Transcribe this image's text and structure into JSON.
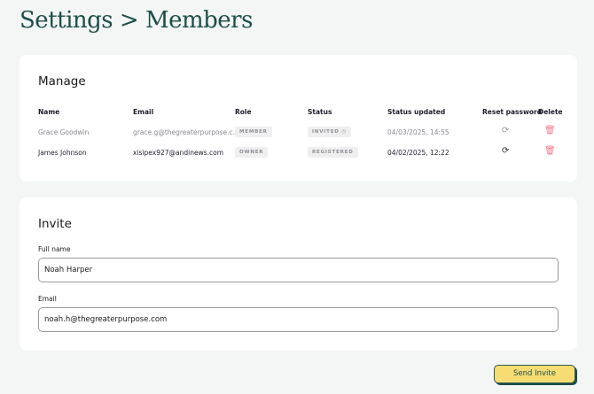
{
  "header": {
    "title": "Settings > Members"
  },
  "manage": {
    "title": "Manage",
    "columns": [
      "Name",
      "Email",
      "Role",
      "Status",
      "Status updated",
      "Reset password",
      "Delete"
    ],
    "rows": [
      {
        "name": "Grace Goodwin",
        "email": "grace.g@thegreaterpurpose.c...",
        "role": "MEMBER",
        "status": "INVITED",
        "status_icon": "clock-icon",
        "updated": "04/03/2025, 14:55",
        "muted": true
      },
      {
        "name": "James Johnson",
        "email": "xisipex927@andinews.com",
        "role": "OWNER",
        "status": "REGISTERED",
        "updated": "04/02/2025, 12:22",
        "muted": false
      }
    ],
    "reset_icon": "refresh-icon",
    "delete_icon": "trash-icon",
    "delete_color": "#f07a8a"
  },
  "invite": {
    "title": "Invite",
    "full_name_label": "Full name",
    "full_name_value": "Noah Harper",
    "email_label": "Email",
    "email_value": "noah.h@thegreaterpurpose.com"
  },
  "send_button": "Send Invite",
  "colors": {
    "brand": "#1c4f4a",
    "button": "#f6dc72",
    "background": "#f3f6f5"
  }
}
